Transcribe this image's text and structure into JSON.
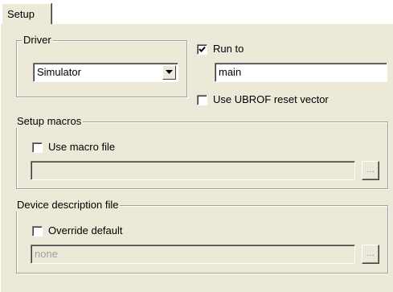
{
  "tabs": [
    {
      "label": "Setup"
    }
  ],
  "driver": {
    "group_label": "Driver",
    "selected": "Simulator"
  },
  "run_to": {
    "label": "Run to",
    "checked": true,
    "value": "main"
  },
  "ubrof": {
    "label": "Use UBROF reset vector",
    "checked": false
  },
  "setup_macros": {
    "group_label": "Setup macros",
    "use_macro_label": "Use macro file",
    "checked": false,
    "path": "",
    "browse_label": "..."
  },
  "device_description": {
    "group_label": "Device description file",
    "override_label": "Override default",
    "checked": false,
    "path": "none",
    "browse_label": "..."
  }
}
